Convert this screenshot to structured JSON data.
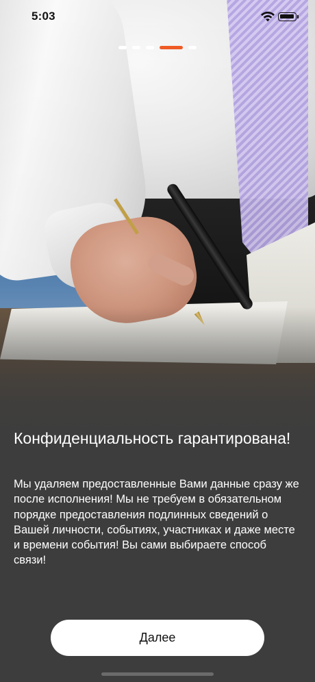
{
  "status_bar": {
    "time": "5:03",
    "wifi_icon": "wifi-icon",
    "battery_icon": "battery-icon"
  },
  "pager": {
    "total_pages": 5,
    "current_page": 4,
    "active_color": "#ef5b25",
    "inactive_color": "#ffffff"
  },
  "hero": {
    "image": "photo of a man in a white shirt and lilac striped tie writing with a fountain pen in a notebook"
  },
  "content": {
    "title": "Конфиденциальность гарантирована!",
    "body": "Мы удаляем предоставленные Вами данные сразу же после исполнения! Мы не требуем в обязательном порядке предоставления подлинных сведений о Вашей личности, событиях, участниках и даже месте и времени события! Вы сами выбираете способ связи!"
  },
  "actions": {
    "next_label": "Далее"
  },
  "colors": {
    "background": "#3d3d3d",
    "accent": "#ef5b25",
    "button_bg": "#ffffff",
    "text": "#ffffff"
  }
}
